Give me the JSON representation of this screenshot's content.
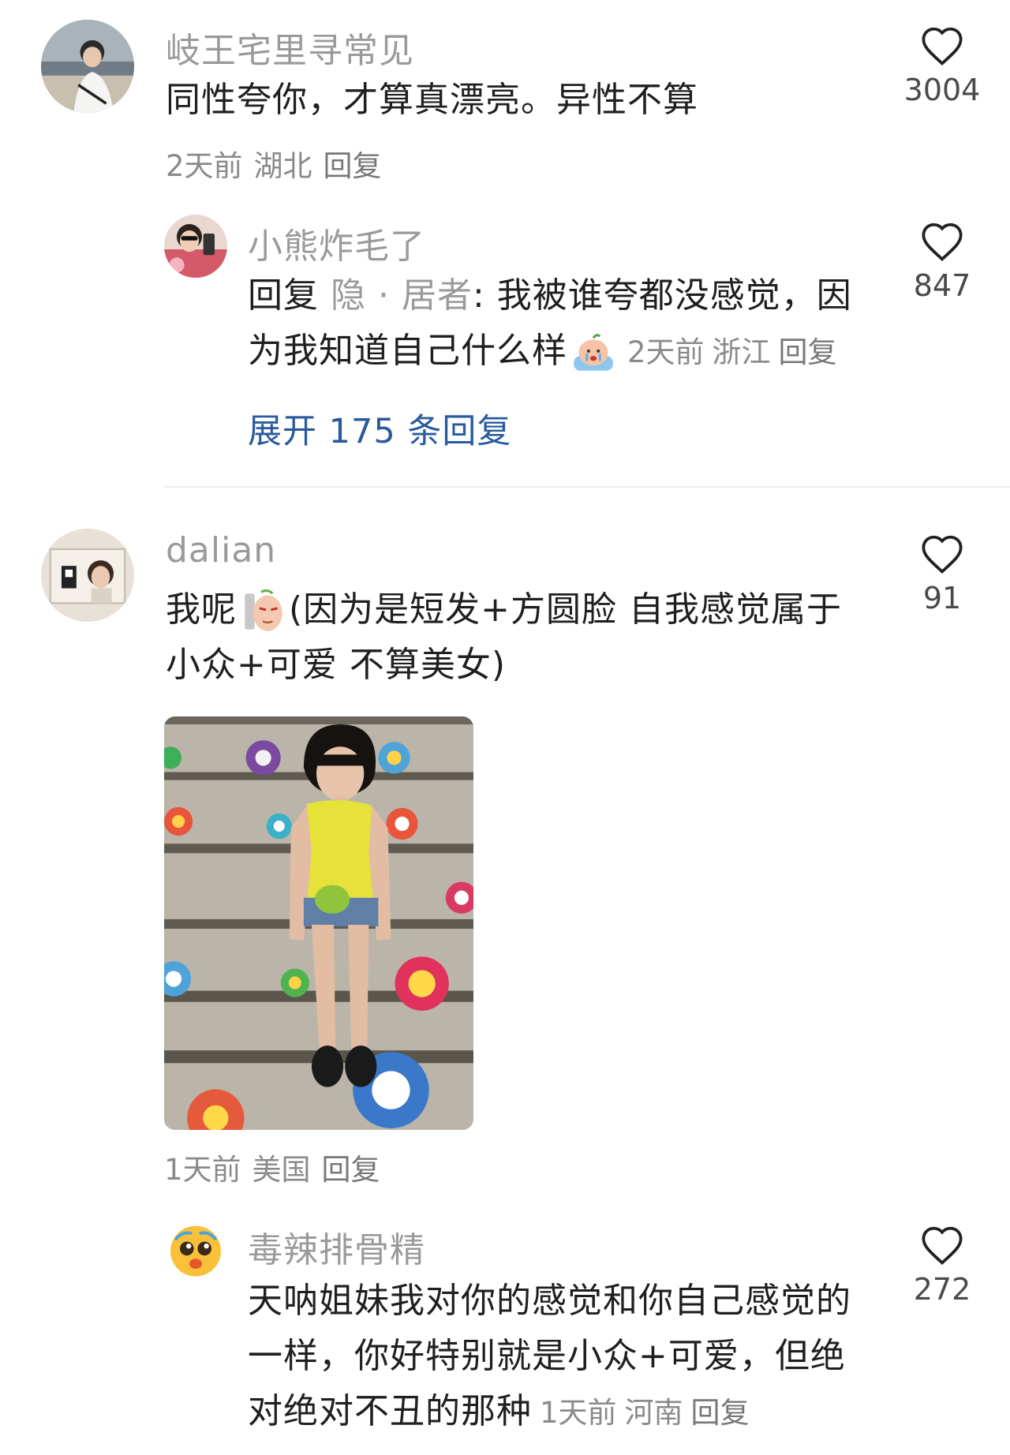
{
  "comments": [
    {
      "username": "岐王宅里寻常见",
      "text": "同性夸你，才算真漂亮。异性不算",
      "meta": {
        "time": "2天前",
        "location": "湖北",
        "reply_label": "回复"
      },
      "likes": "3004",
      "avatar_icon": "avatar-photo-person-seaside"
    },
    {
      "username": "dalian",
      "text_a": "我呢",
      "text_b": "(因为是短发+方圆脸 自我感觉属于",
      "text_c": "小众+可爱 不算美女)",
      "meta": {
        "time": "1天前",
        "location": "美国",
        "reply_label": "回复"
      },
      "likes": "91",
      "avatar_icon": "avatar-photo-room",
      "emoji_icon": "smirk-face-emoji",
      "attachment_icon": "photo-girl-on-flower-stairs"
    }
  ],
  "replies": [
    {
      "username": "小熊炸毛了",
      "prefix": "回复",
      "mention": "隐 · 居者",
      "text_line1": ": 我被谁夸都没感觉，因",
      "text_line2": "为我知道自己什么样",
      "meta": {
        "time": "2天前",
        "location": "浙江",
        "reply_label": "回复"
      },
      "likes": "847",
      "avatar_icon": "avatar-photo-selfie",
      "emoji_icon": "crying-bath-emoji"
    },
    {
      "username": "毒辣排骨精",
      "text_line1": "天呐姐妹我对你的感觉和你自己感觉的",
      "text_line2": "一样，你好特别就是小众+可爱，但绝",
      "text_line3": "对绝对不丑的那种",
      "meta": {
        "time": "1天前",
        "location": "河南",
        "reply_label": "回复"
      },
      "likes": "272",
      "avatar_icon": "avatar-pleading-emoji"
    }
  ],
  "expand_replies": "展开 175 条回复",
  "colors": {
    "username": "#9a9a9a",
    "text": "#1f1f1f",
    "meta": "#8a8a8a",
    "link": "#2a5a9c"
  }
}
